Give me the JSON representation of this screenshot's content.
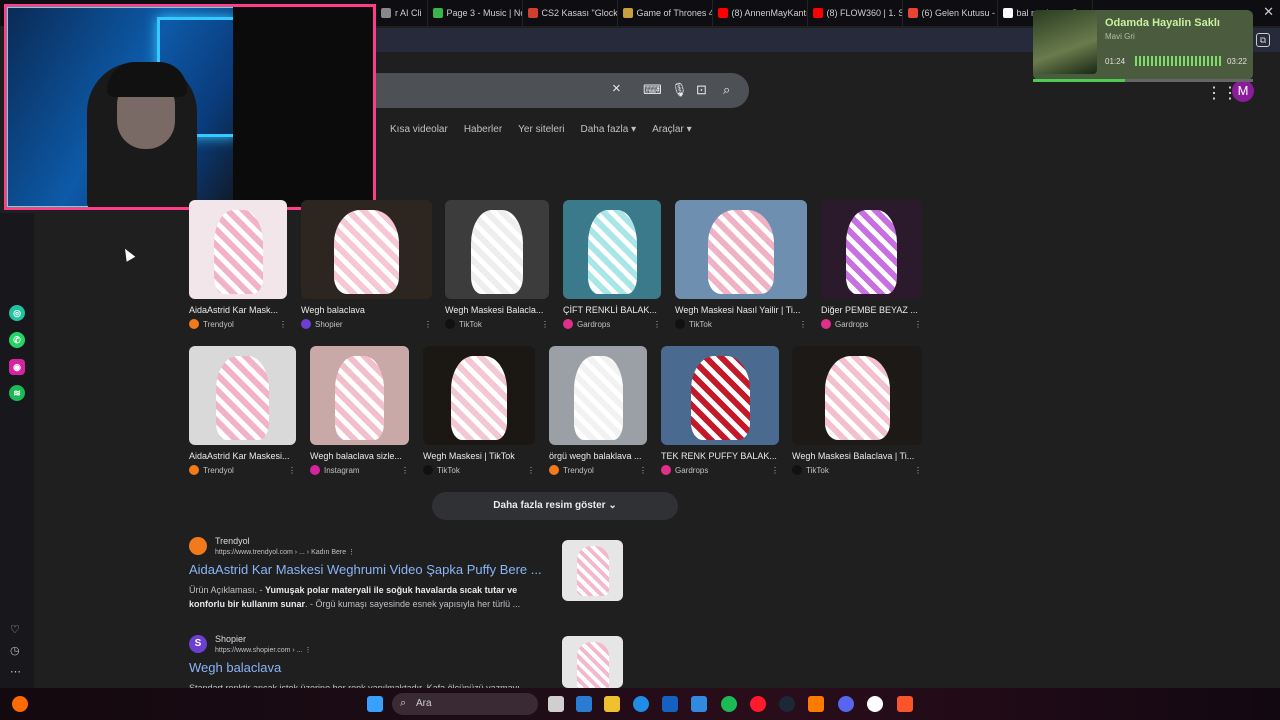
{
  "tabs": [
    {
      "label": "r AI Cli",
      "color": "#888888"
    },
    {
      "label": "Page 3 - Music | No",
      "color": "#3ab54a"
    },
    {
      "label": "CS2 Kasası \"Glock-",
      "color": "#d04030"
    },
    {
      "label": "Game of Thrones 4",
      "color": "#c8a040"
    },
    {
      "label": "(8) AnnenMayKantı",
      "color": "#ff0000"
    },
    {
      "label": "(8) FLOW360 | 1. S",
      "color": "#ff0000"
    },
    {
      "label": "(6) Gelen Kutusu -",
      "color": "#ea4335"
    },
    {
      "label": "bal markası - Goog",
      "color": "#ffffff"
    }
  ],
  "search": {
    "close_icon": "×"
  },
  "filters": [
    "Kısa videolar",
    "Haberler",
    "Yer siteleri",
    "Daha fazla ▾",
    "Araçlar ▾"
  ],
  "images_row1": [
    {
      "title": "AidaAstrid Kar Mask...",
      "source": "Trendyol",
      "src_color": "#f27a1a",
      "bg": "#f3e6ea",
      "mask": "#f2b3c8"
    },
    {
      "title": "Wegh balaclava",
      "source": "Shopier",
      "src_color": "#6c3fd1",
      "bg": "#2d2520",
      "mask": "#f6c7d4"
    },
    {
      "title": "Wegh Maskesi Balacla...",
      "source": "TikTok",
      "src_color": "#111111",
      "bg": "#3c3c3c",
      "mask": "#eeeeee"
    },
    {
      "title": "ÇİFT RENKLİ BALAK...",
      "source": "Gardrops",
      "src_color": "#e0308a",
      "bg": "#3b7a8a",
      "mask": "#a9e6e8"
    },
    {
      "title": "Wegh Maskesi Nasıl Yailir | Ti...",
      "source": "TikTok",
      "src_color": "#111111",
      "bg": "#6f8fb0",
      "mask": "#f0b3c6"
    },
    {
      "title": "Diğer PEMBE BEYAZ ...",
      "source": "Gardrops",
      "src_color": "#e0308a",
      "bg": "#2b1a2c",
      "mask": "#c770e0"
    }
  ],
  "images_row2": [
    {
      "title": "AidaAstrid Kar Maskesi...",
      "source": "Trendyol",
      "src_color": "#f27a1a",
      "bg": "#d9d9d9",
      "mask": "#f2b3c8"
    },
    {
      "title": "Wegh balaclava sizle...",
      "source": "Instagram",
      "src_color": "#d6249f",
      "bg": "#c9a8a8",
      "mask": "#f2c0cc"
    },
    {
      "title": "Wegh Maskesi | TikTok",
      "source": "TikTok",
      "src_color": "#111111",
      "bg": "#1b1713",
      "mask": "#f4c7d4"
    },
    {
      "title": "örgü wegh balaklava ...",
      "source": "Trendyol",
      "src_color": "#f27a1a",
      "bg": "#9aa0a6",
      "mask": "#f2f2f2"
    },
    {
      "title": "TEK RENK PUFFY BALAK...",
      "source": "Gardrops",
      "src_color": "#e0308a",
      "bg": "#4a6a8f",
      "mask": "#c31a2a"
    },
    {
      "title": "Wegh Maskesi Balaclava | Ti...",
      "source": "TikTok",
      "src_color": "#111111",
      "bg": "#1d1917",
      "mask": "#f3c0cf"
    }
  ],
  "more_images": "Daha fazla resim göster",
  "results": [
    {
      "site": "Trendyol",
      "url": "https://www.trendyol.com › ... › Kadın Bere",
      "title": "AidaAstrid Kar Maskesi Weghrumi Video Şapka Puffy Bere ...",
      "snippet_pre": "Ürün Açıklaması. - ",
      "snippet_bold": "Yumuşak polar materyali ile soğuk havalarda sıcak tutar ve konforlu bir kullanım sunar",
      "snippet_post": ". - Örgü kumaşı sayesinde esnek yapısıyla her türlü ...",
      "fav_color": "#f27a1a"
    },
    {
      "site": "Shopier",
      "url": "https://www.shopier.com › ...",
      "title": "Wegh balaclava",
      "snippet_pre": "Standart renktir ancak istek üzerine her renk yapılmaktadır. Kafa ölçünüzü yazmayı ...",
      "snippet_bold": "",
      "snippet_post": "",
      "fav_color": "#6c3fd1"
    }
  ],
  "spotify": {
    "song": "Odamda Hayalin Saklı",
    "artist": "Mavi Gri",
    "current": "01:24",
    "total": "03:22",
    "progress": 0.42
  },
  "taskbar": {
    "search_label": "Ara"
  },
  "avatar_letter": "M"
}
